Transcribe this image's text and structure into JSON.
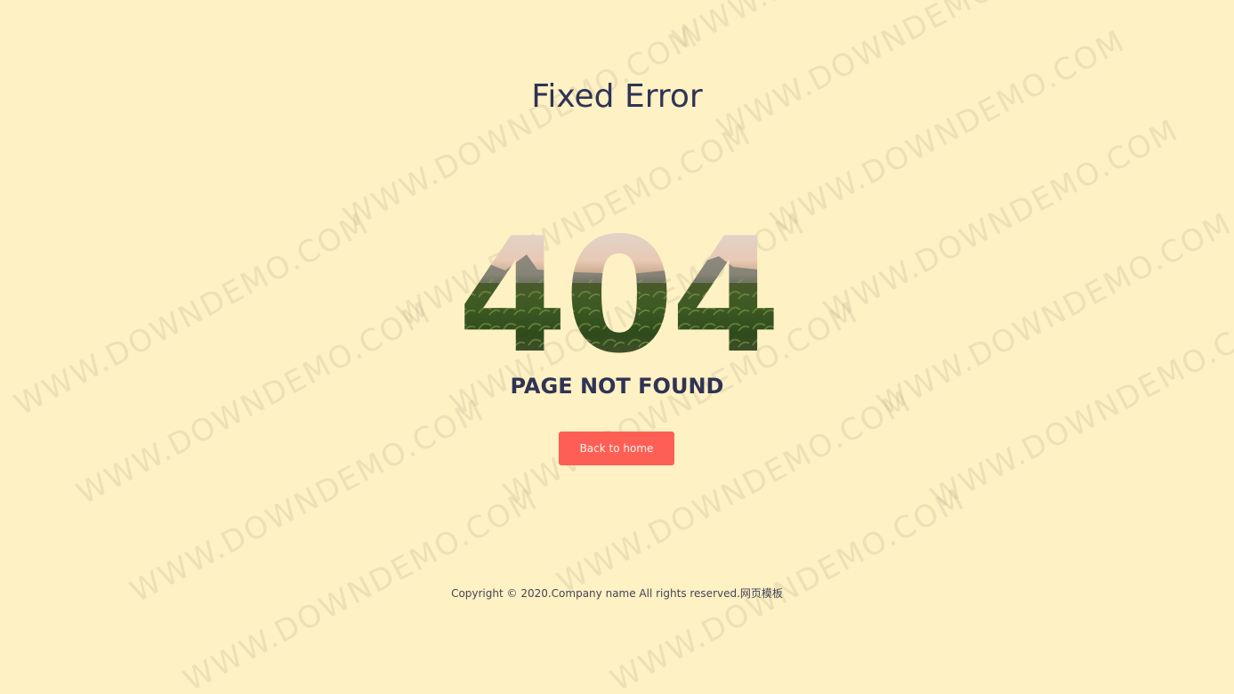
{
  "header": {
    "title": "Fixed Error"
  },
  "error": {
    "code": "404",
    "message": "PAGE NOT FOUND"
  },
  "actions": {
    "home_label": "Back to home"
  },
  "footer": {
    "copyright": "Copyright © 2020.Company name All rights reserved.网页模板"
  },
  "watermark": {
    "text": "WWW.DOWNDEMO.COM"
  },
  "colors": {
    "background": "#fef1c3",
    "text_primary": "#2f3356",
    "button_bg": "#fe5f55",
    "button_text": "#fff3ee"
  }
}
